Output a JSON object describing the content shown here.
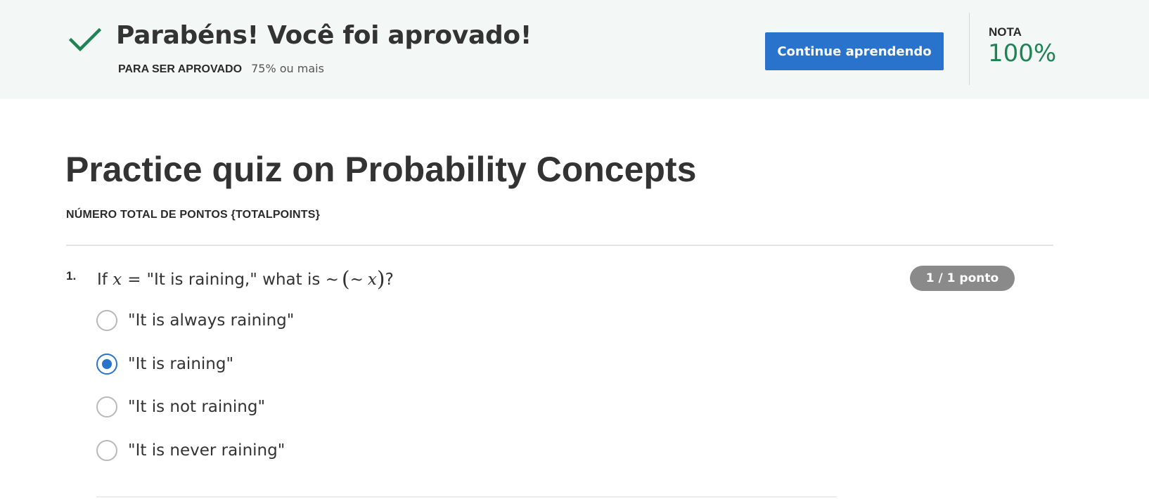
{
  "banner": {
    "title": "Parabéns! Você foi aprovado!",
    "pass_label": "PARA SER APROVADO",
    "pass_value": "75% ou mais",
    "continue_label": "Continue aprendendo",
    "grade_label": "NOTA",
    "grade_value": "100%",
    "check_icon": "check-icon"
  },
  "quiz": {
    "title": "Practice quiz on Probability Concepts",
    "total_points_label": "NÚMERO TOTAL DE PONTOS {TOTALPOINTS}"
  },
  "question": {
    "number": "1.",
    "text_prefix": "If ",
    "var_x": "x",
    "equals": "=",
    "text_middle": "\"It is raining,\" what is ",
    "tilde1": "∼",
    "paren_open": "(",
    "tilde2": "∼",
    "var_x2": "x",
    "paren_close": ")",
    "text_suffix": "?",
    "score": "1 / 1 ponto",
    "options": [
      {
        "label": "\"It is always raining\"",
        "selected": false
      },
      {
        "label": "\"It is raining\"",
        "selected": true
      },
      {
        "label": "\"It is not raining\"",
        "selected": false
      },
      {
        "label": "\"It is never raining\"",
        "selected": false
      }
    ]
  },
  "colors": {
    "banner_bg": "#f3f8f6",
    "accent_blue": "#2a73cc",
    "success_green": "#1f8354",
    "badge_gray": "#8a8a8a"
  }
}
